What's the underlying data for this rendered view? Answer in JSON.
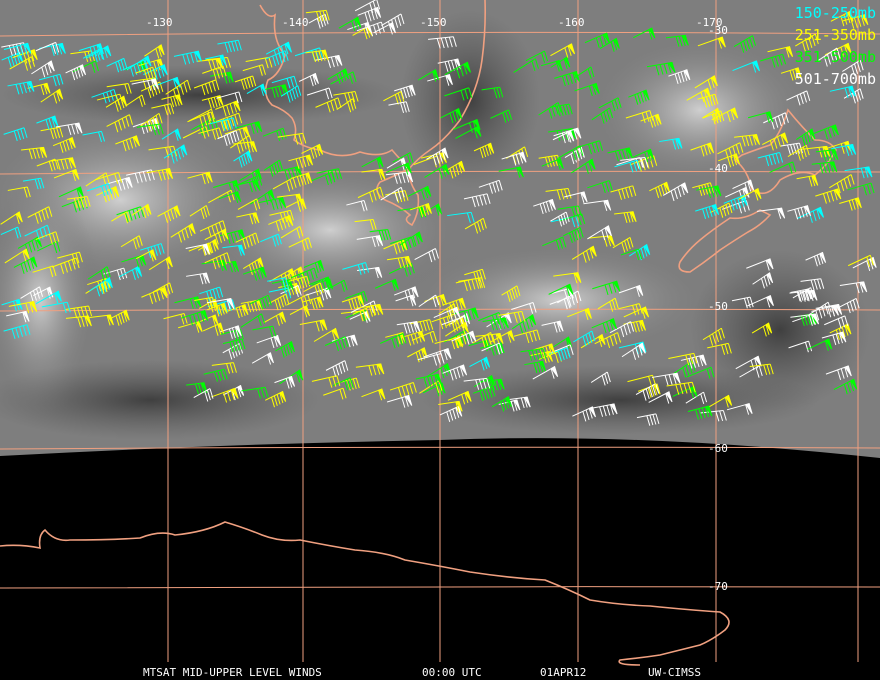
{
  "legend": [
    {
      "label": "150-250mb",
      "color": "#00ffff"
    },
    {
      "label": "251-350mb",
      "color": "#ffff00"
    },
    {
      "label": "351-500mb",
      "color": "#00ff00"
    },
    {
      "label": "501-700mb",
      "color": "#ffffff"
    }
  ],
  "longitudes": [
    "-130",
    "-140",
    "-150",
    "-160",
    "-170"
  ],
  "latitudes": [
    "-30",
    "-40",
    "-50",
    "-60",
    "-70"
  ],
  "caption": {
    "product": "MTSAT MID-UPPER LEVEL WINDS",
    "time": "00:00 UTC",
    "date": "01APR12",
    "source": "UW-CIMSS"
  },
  "colors": {
    "grid": "#f0a080",
    "coast": "#f0a080",
    "space": "#000000",
    "cloud": "#8c8c8c"
  }
}
